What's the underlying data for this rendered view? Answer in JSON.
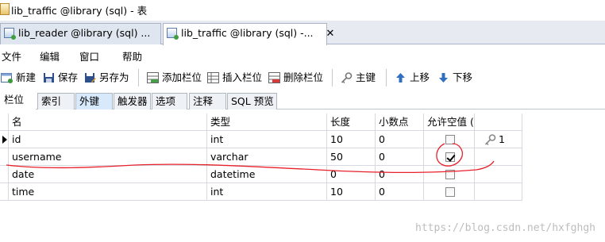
{
  "window": {
    "title": "lib_traffic @library (sql) - 表"
  },
  "tabs": [
    {
      "label": "lib_reader @library (sql) ...",
      "active": false
    },
    {
      "label": "lib_traffic @library (sql) -...",
      "active": true,
      "close": "✕"
    }
  ],
  "menu": [
    "文件",
    "编辑",
    "窗口",
    "帮助"
  ],
  "toolbar": {
    "new": "新建",
    "save": "保存",
    "save_as": "另存为",
    "add_field": "添加栏位",
    "insert_field": "插入栏位",
    "delete_field": "删除栏位",
    "primary_key": "主键",
    "move_up": "上移",
    "move_down": "下移"
  },
  "subtabs": [
    "栏位",
    "索引",
    "外键",
    "触发器",
    "选项",
    "注释",
    "SQL 预览"
  ],
  "columns": {
    "name": "名",
    "type": "类型",
    "length": "长度",
    "decimals": "小数点",
    "allow_null": "允许空值 ("
  },
  "rows": [
    {
      "name": "id",
      "type": "int",
      "length": "10",
      "decimals": "0",
      "allow_null": false,
      "key": "1",
      "current": true
    },
    {
      "name": "username",
      "type": "varchar",
      "length": "50",
      "decimals": "0",
      "allow_null": true
    },
    {
      "name": "date",
      "type": "datetime",
      "length": "0",
      "decimals": "0",
      "allow_null": false
    },
    {
      "name": "time",
      "type": "int",
      "length": "10",
      "decimals": "0",
      "allow_null": false
    }
  ],
  "icons": {
    "key": "key-icon",
    "current_row": "row-pointer-icon"
  },
  "annotation_color": "#e8202a",
  "watermark": "https://blog.csdn.net/hxfghgh"
}
